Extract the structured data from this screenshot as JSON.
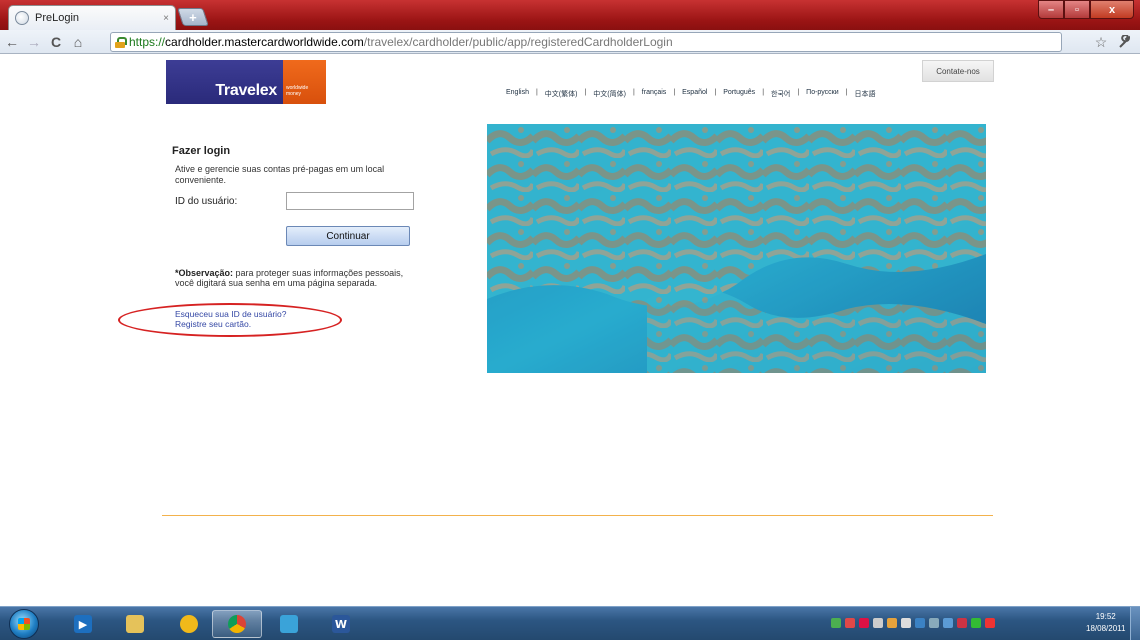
{
  "browser": {
    "tab_title": "PreLogin",
    "tab_close": "×",
    "new_tab": "+",
    "url_scheme": "https://",
    "url_host": "cardholder.mastercardworldwide.com",
    "url_path": "/travelex/cardholder/public/app/registeredCardholderLogin",
    "back": "←",
    "forward": "→",
    "reload": "C",
    "home": "⌂",
    "star": "☆",
    "wrench": "🔧",
    "window_min": "–",
    "window_max": "▫",
    "window_close": "x"
  },
  "header": {
    "logo_text": "Travelex",
    "logo_tagline": "worldwide money",
    "contact_label": "Contate-nos",
    "languages": [
      "English",
      "中文(繁体)",
      "中文(简体)",
      "français",
      "Español",
      "Português",
      "한국어",
      "По-русски",
      "日本語"
    ]
  },
  "login": {
    "title": "Fazer login",
    "description": "Ative e gerencie suas contas pré-pagas em um local conveniente.",
    "userid_label": "ID do usuário:",
    "userid_value": "",
    "continue_label": "Continuar",
    "note_bold": "*Observação:",
    "note_text": " para proteger suas informações pessoais, você digitará sua senha em uma página separada.",
    "forgot_link": "Esqueceu sua ID de usuário?",
    "register_link": "Registre seu cartão."
  },
  "taskbar": {
    "clock_time": "19:52",
    "clock_date": "18/08/2011",
    "word_label": "W"
  },
  "colors": {
    "travelex_blue": "#2f2f86",
    "travelex_orange": "#e55a12",
    "link": "#3548a5",
    "annotation": "#d62222",
    "rule": "#f3b24c"
  }
}
